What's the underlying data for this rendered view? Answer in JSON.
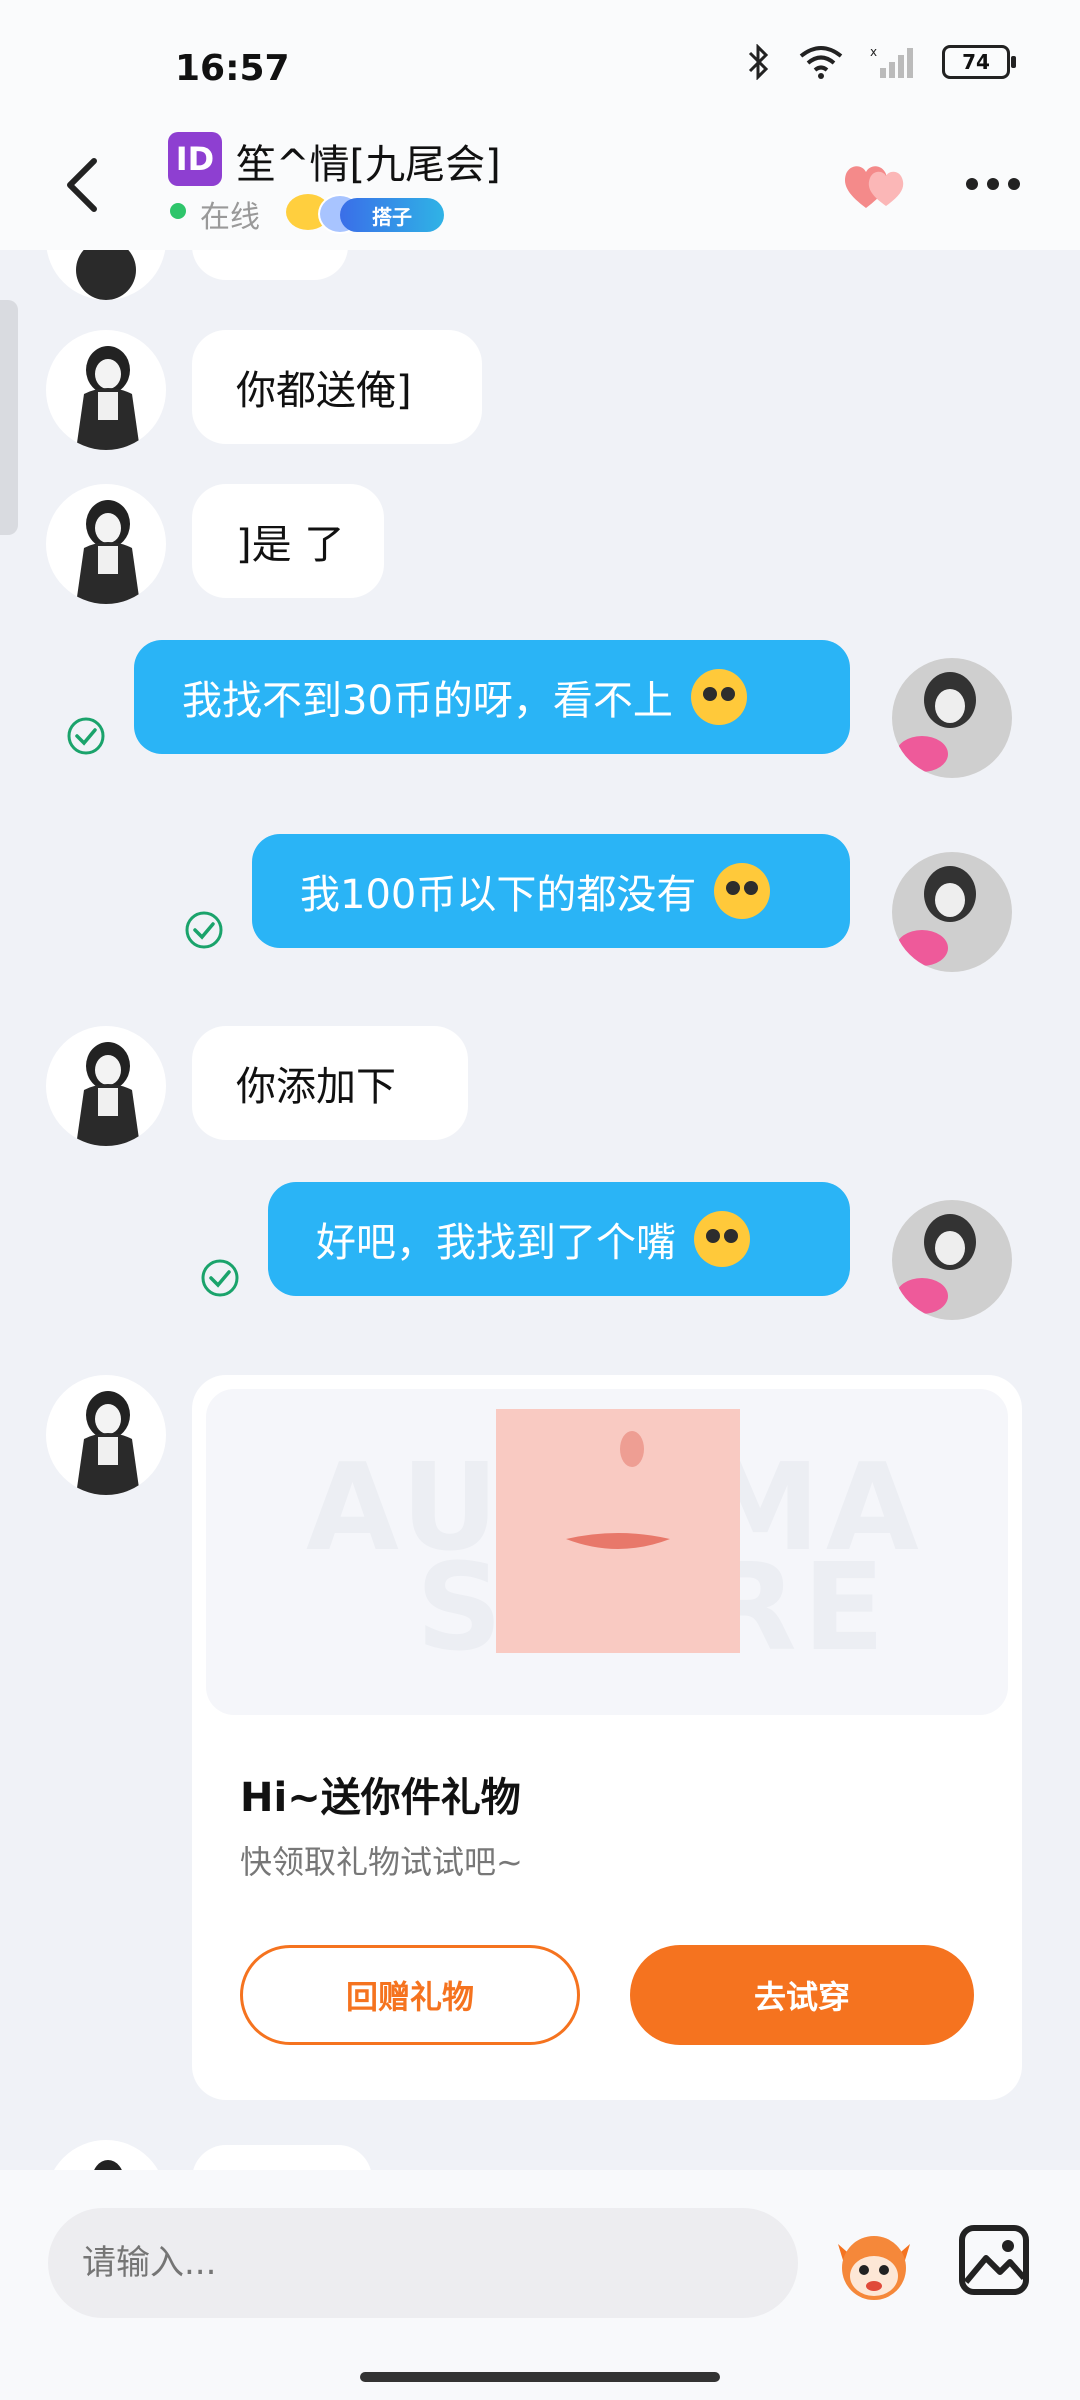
{
  "status": {
    "time": "16:57",
    "battery": "74"
  },
  "header": {
    "id_badge": "ID",
    "contact_name": "笙^情[九尾会]",
    "online_status": "在线",
    "tag": "搭子"
  },
  "messages": [
    {
      "side": "left",
      "text": "你都送俺]"
    },
    {
      "side": "left",
      "text": "]是 了"
    },
    {
      "side": "right",
      "text": "我找不到30币的呀，看不上"
    },
    {
      "side": "right",
      "text": "我100币以下的都没有"
    },
    {
      "side": "left",
      "text": "你添加下"
    },
    {
      "side": "right",
      "text": "好吧，我找到了个嘴"
    }
  ],
  "gift_card": {
    "watermark_top": "AUTOMA",
    "watermark_bottom": "STORE",
    "title": "Hi~送你件礼物",
    "subtitle": "快领取礼物试试吧~",
    "return_gift_label": "回赠礼物",
    "try_on_label": "去试穿"
  },
  "input": {
    "placeholder": "请输入..."
  },
  "colors": {
    "sent_bubble": "#2ab4f6",
    "accent_orange": "#f5731f",
    "online_green": "#2ec56b"
  }
}
